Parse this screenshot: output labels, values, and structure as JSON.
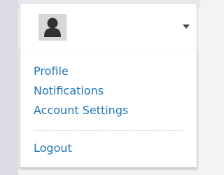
{
  "user_menu": {
    "avatar_icon": "user-icon",
    "toggle_icon": "chevron-down-icon",
    "items": [
      {
        "label": "Profile"
      },
      {
        "label": "Notifications"
      },
      {
        "label": "Account Settings"
      },
      {
        "label": "Logout"
      }
    ]
  },
  "colors": {
    "link": "#1f74b6",
    "panel_background": "#ffffff",
    "avatar_background": "#d7d7d7"
  }
}
